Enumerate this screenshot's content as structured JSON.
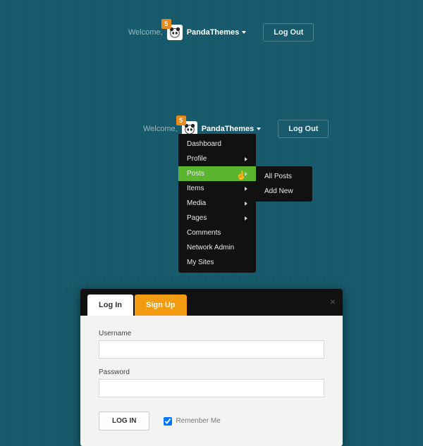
{
  "topbar": {
    "welcome": "Welcome,",
    "badge": "5",
    "username": "PandaThemes",
    "logout": "Log Out"
  },
  "menu": {
    "items": [
      {
        "label": "Dashboard",
        "sub": false
      },
      {
        "label": "Profile",
        "sub": true
      },
      {
        "label": "Posts",
        "sub": true,
        "hover": true
      },
      {
        "label": "Items",
        "sub": true
      },
      {
        "label": "Media",
        "sub": true
      },
      {
        "label": "Pages",
        "sub": true
      },
      {
        "label": "Comments",
        "sub": false
      },
      {
        "label": "Network Admin",
        "sub": false
      },
      {
        "label": "My Sites",
        "sub": false
      }
    ],
    "submenu": [
      {
        "label": "All Posts"
      },
      {
        "label": "Add New"
      }
    ]
  },
  "modal": {
    "tab_login": "Log In",
    "tab_signup": "Sign Up",
    "username_label": "Username",
    "username_value": "",
    "password_label": "Password",
    "password_value": "",
    "submit": "LOG IN",
    "remember": "Remenber Me",
    "remember_checked": true
  }
}
